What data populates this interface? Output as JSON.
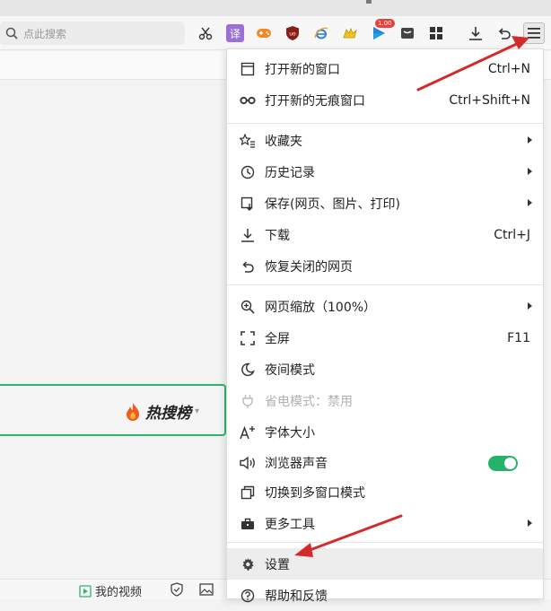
{
  "search": {
    "placeholder": "点此搜索"
  },
  "toolbar": {
    "badge": "1.00",
    "icons": [
      "cut-icon",
      "translate-icon",
      "game-icon",
      "ublock-icon",
      "ie-icon",
      "pikachu-icon",
      "play-icon",
      "reader-icon",
      "apps-icon",
      "download-icon",
      "undo-icon",
      "menu-icon"
    ],
    "translate_glyph": "译",
    "ublock_glyph": "uo"
  },
  "hot": {
    "label": "热搜榜"
  },
  "bottom": {
    "video_label": "我的视频"
  },
  "colors": {
    "accent_green": "#2db46d",
    "arrow_red": "#d42a2a",
    "toggle_on": "#25b36b"
  },
  "menu": {
    "new_window": {
      "label": "打开新的窗口",
      "shortcut": "Ctrl+N"
    },
    "new_incognito": {
      "label": "打开新的无痕窗口",
      "shortcut": "Ctrl+Shift+N"
    },
    "favorites": {
      "label": "收藏夹"
    },
    "history": {
      "label": "历史记录"
    },
    "save": {
      "label": "保存(网页、图片、打印)"
    },
    "download": {
      "label": "下载",
      "shortcut": "Ctrl+J"
    },
    "restore": {
      "label": "恢复关闭的网页"
    },
    "zoom": {
      "label": "网页缩放（100%）"
    },
    "fullscreen": {
      "label": "全屏",
      "shortcut": "F11"
    },
    "night": {
      "label": "夜间模式"
    },
    "power": {
      "label": "省电模式：禁用"
    },
    "font": {
      "label": "字体大小"
    },
    "sound": {
      "label": "浏览器声音",
      "enabled": true
    },
    "multiwin": {
      "label": "切换到多窗口模式"
    },
    "tools": {
      "label": "更多工具"
    },
    "settings": {
      "label": "设置"
    },
    "help": {
      "label": "帮助和反馈"
    }
  }
}
